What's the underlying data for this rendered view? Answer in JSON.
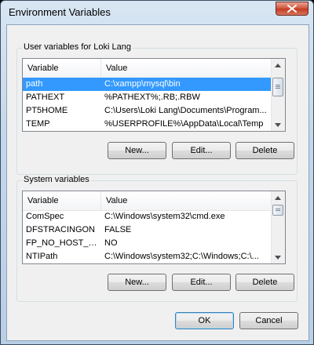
{
  "window": {
    "title": "Environment Variables"
  },
  "user_vars": {
    "group_label": "User variables for Loki Lang",
    "columns": [
      "Variable",
      "Value"
    ],
    "rows": [
      {
        "variable": "path",
        "value": "C:\\xampp\\mysql\\bin",
        "selected": true
      },
      {
        "variable": "PATHEXT",
        "value": "%PATHEXT%;.RB;.RBW"
      },
      {
        "variable": "PT5HOME",
        "value": "C:\\Users\\Loki Lang\\Documents\\Program..."
      },
      {
        "variable": "TEMP",
        "value": "%USERPROFILE%\\AppData\\Local\\Temp"
      }
    ],
    "buttons": {
      "new": "New...",
      "edit": "Edit...",
      "delete": "Delete"
    }
  },
  "system_vars": {
    "group_label": "System variables",
    "columns": [
      "Variable",
      "Value"
    ],
    "rows": [
      {
        "variable": "ComSpec",
        "value": "C:\\Windows\\system32\\cmd.exe"
      },
      {
        "variable": "DFSTRACINGON",
        "value": "FALSE"
      },
      {
        "variable": "FP_NO_HOST_C...",
        "value": "NO"
      },
      {
        "variable": "NTIPath",
        "value": "C:\\Windows\\system32;C:\\Windows;C:\\..."
      }
    ],
    "buttons": {
      "new": "New...",
      "edit": "Edit...",
      "delete": "Delete"
    }
  },
  "dialog_buttons": {
    "ok": "OK",
    "cancel": "Cancel"
  },
  "icons": {
    "close": "close-icon",
    "scroll_up": "arrow-up-icon",
    "scroll_down": "arrow-down-icon"
  },
  "colors": {
    "selection": "#3399ff",
    "close_button": "#c13a22"
  }
}
